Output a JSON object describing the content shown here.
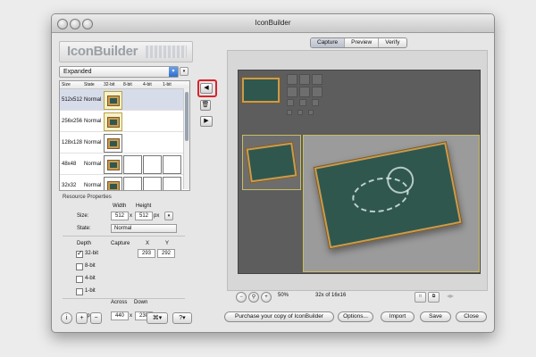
{
  "window": {
    "title": "IconBuilder"
  },
  "logo": {
    "text": "IconBuilder"
  },
  "variant_dropdown": {
    "value": "Expanded"
  },
  "table": {
    "headers": [
      "Size",
      "State",
      "32-bit",
      "8-bit",
      "4-bit",
      "1-bit"
    ],
    "rows": [
      {
        "size": "512x512",
        "state": "Normal"
      },
      {
        "size": "256x256",
        "state": "Normal"
      },
      {
        "size": "128x128",
        "state": "Normal"
      },
      {
        "size": "48x48",
        "state": "Normal"
      },
      {
        "size": "32x32",
        "state": "Normal"
      }
    ]
  },
  "resource_properties": {
    "title": "Resource Properties",
    "size_label": "Size:",
    "width_label": "Width",
    "height_label": "Height",
    "width": "512",
    "height": "512",
    "x_sep": "x",
    "px": "px",
    "state_label": "State:",
    "state_value": "Normal",
    "depth_label": "Depth",
    "capture_label": "Capture",
    "x_label": "X",
    "y_label": "Y",
    "depths": [
      "32-bit",
      "8-bit",
      "4-bit",
      "1-bit"
    ],
    "capture_x": "293",
    "capture_y": "292",
    "jump_label": "Jump:",
    "across_label": "Across",
    "down_label": "Down",
    "across": "440",
    "down": "230",
    "jump_px": "px"
  },
  "tabs": {
    "items": [
      "Capture",
      "Preview",
      "Verify"
    ],
    "active": "Capture"
  },
  "zoom": {
    "percent": "50%",
    "info": "32x of 16x16"
  },
  "footer_buttons": {
    "purchase": "Purchase your copy of IconBuilder",
    "options": "Options...",
    "import": "Import",
    "save": "Save",
    "close": "Close"
  },
  "colors": {
    "accent": "#d8232a",
    "board_frame": "#c99b52",
    "board": "#2f574d",
    "canvas": "#5d5d5d",
    "selection": "#d6dcea"
  }
}
